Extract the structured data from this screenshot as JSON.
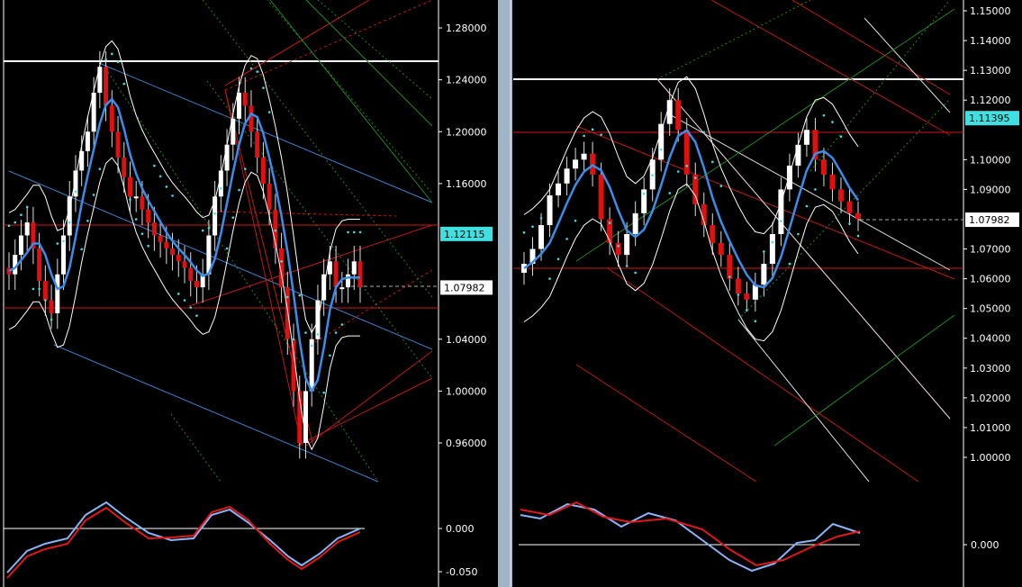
{
  "charts": {
    "left": {
      "price_ticks": [
        "1.28000",
        "1.24000",
        "1.20000",
        "1.16000",
        "1.12115",
        "1.07982",
        "1.04000",
        "1.00000",
        "0.96000"
      ],
      "macd_ticks": [
        "0.000",
        "-0.050"
      ],
      "labels": {
        "bid": "1.07982",
        "marker": "1.12115"
      },
      "marker_color": "#40e0e0"
    },
    "right": {
      "price_ticks": [
        "1.15000",
        "1.14000",
        "1.13000",
        "1.12000",
        "1.11395",
        "1.11000",
        "1.10000",
        "1.09000",
        "1.07982",
        "1.07000",
        "1.06000",
        "1.05000",
        "1.04000",
        "1.03000",
        "1.02000",
        "1.01000",
        "1.00000"
      ],
      "macd_ticks": [
        "0.000"
      ],
      "labels": {
        "bid": "1.07982",
        "marker": "1.11395"
      },
      "marker_color": "#40e0e0"
    }
  },
  "chart_data": [
    {
      "type": "candlestick",
      "panel": "left",
      "ylim": [
        0.94,
        1.3
      ],
      "close": [
        1.09,
        1.105,
        1.12,
        1.13,
        1.11,
        1.085,
        1.07,
        1.06,
        1.09,
        1.12,
        1.15,
        1.17,
        1.185,
        1.2,
        1.23,
        1.25,
        1.22,
        1.2,
        1.18,
        1.165,
        1.15,
        1.15,
        1.14,
        1.13,
        1.12,
        1.115,
        1.11,
        1.105,
        1.1,
        1.095,
        1.085,
        1.08,
        1.09,
        1.12,
        1.15,
        1.17,
        1.19,
        1.21,
        1.23,
        1.22,
        1.2,
        1.18,
        1.16,
        1.14,
        1.11,
        1.08,
        1.04,
        1.0,
        0.96,
        1.0,
        1.04,
        1.07,
        1.09,
        1.1,
        1.08,
        1.08,
        1.09,
        1.1,
        1.08
      ],
      "series": [
        {
          "name": "",
          "role": "moving average"
        }
      ],
      "macd": {
        "ylim": [
          -0.06,
          0.02
        ]
      }
    },
    {
      "type": "candlestick",
      "panel": "right",
      "ylim": [
        0.995,
        1.155
      ],
      "close": [
        1.065,
        1.07,
        1.078,
        1.088,
        1.092,
        1.097,
        1.1,
        1.102,
        1.095,
        1.08,
        1.072,
        1.068,
        1.075,
        1.082,
        1.09,
        1.1,
        1.112,
        1.12,
        1.11,
        1.095,
        1.085,
        1.078,
        1.072,
        1.068,
        1.06,
        1.055,
        1.053,
        1.058,
        1.065,
        1.075,
        1.09,
        1.098,
        1.105,
        1.11,
        1.1,
        1.095,
        1.09,
        1.086,
        1.082,
        1.08
      ],
      "series": [
        {
          "name": "",
          "role": "moving average"
        }
      ],
      "macd": {
        "ylim": [
          -0.01,
          0.015
        ]
      }
    }
  ]
}
